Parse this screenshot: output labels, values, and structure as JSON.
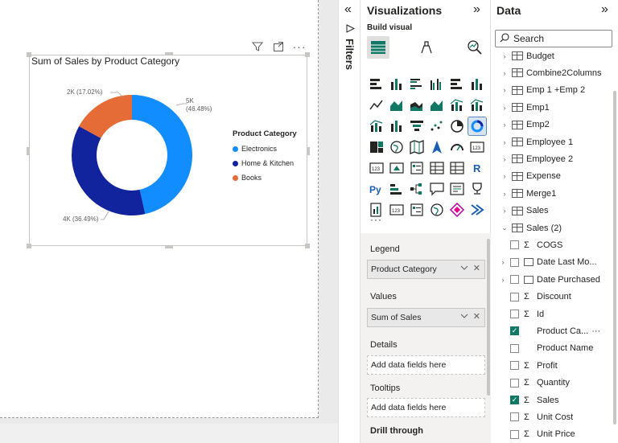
{
  "canvas": {
    "chart": {
      "title": "Sum of Sales by Product Category",
      "legend_title": "Product Category",
      "labels": {
        "electronics": "5K",
        "electronics_pct": "(46.48%)",
        "home_kitchen": "4K (36.49%)",
        "books": "2K (17.02%)"
      },
      "colors": {
        "electronics": "#118DFF",
        "home_kitchen": "#12239E",
        "books": "#E66C37"
      }
    },
    "header_icons": [
      "filter-icon",
      "focus-mode-icon",
      "more-options-icon"
    ]
  },
  "chart_data": {
    "type": "pie",
    "title": "Sum of Sales by Product Category",
    "legend_title": "Product Category",
    "categories": [
      "Electronics",
      "Home & Kitchen",
      "Books"
    ],
    "values_label": [
      "5K",
      "4K",
      "2K"
    ],
    "percentages": [
      46.48,
      36.49,
      17.02
    ],
    "colors": [
      "#118DFF",
      "#12239E",
      "#E66C37"
    ],
    "donut": true,
    "legend_position": "right"
  },
  "filters": {
    "label": "Filters"
  },
  "visualizations": {
    "title": "Visualizations",
    "build_label": "Build visual",
    "more": "···",
    "wells": {
      "legend_label": "Legend",
      "legend_field": "Product Category",
      "values_label": "Values",
      "values_field": "Sum of Sales",
      "details_label": "Details",
      "details_placeholder": "Add data fields here",
      "tooltips_label": "Tooltips",
      "tooltips_placeholder": "Add data fields here",
      "drill_label": "Drill through"
    }
  },
  "data": {
    "title": "Data",
    "search_placeholder": "Search",
    "tables": [
      "Budget",
      "Combine2Columns",
      "Emp 1 +Emp 2",
      "Emp1",
      "Emp2",
      "Employee 1",
      "Employee 2",
      "Expense",
      "Merge1",
      "Sales",
      "Sales (2)"
    ],
    "fields": [
      {
        "name": "COGS",
        "type": "sigma",
        "checked": false,
        "expand": false
      },
      {
        "name": "Date Last Mo...",
        "type": "date",
        "checked": false,
        "expand": true
      },
      {
        "name": "Date Purchased",
        "type": "date",
        "checked": false,
        "expand": true
      },
      {
        "name": "Discount",
        "type": "sigma",
        "checked": false,
        "expand": false
      },
      {
        "name": "Id",
        "type": "sigma",
        "checked": false,
        "expand": false
      },
      {
        "name": "Product Ca...",
        "type": "text",
        "checked": true,
        "expand": false
      },
      {
        "name": "Product Name",
        "type": "text",
        "checked": false,
        "expand": false
      },
      {
        "name": "Profit",
        "type": "sigma",
        "checked": false,
        "expand": false
      },
      {
        "name": "Quantity",
        "type": "sigma",
        "checked": false,
        "expand": false
      },
      {
        "name": "Sales",
        "type": "sigma",
        "checked": true,
        "expand": false
      },
      {
        "name": "Unit Cost",
        "type": "sigma",
        "checked": false,
        "expand": false
      },
      {
        "name": "Unit Price",
        "type": "sigma",
        "checked": false,
        "expand": false
      }
    ],
    "field_more": "···"
  }
}
